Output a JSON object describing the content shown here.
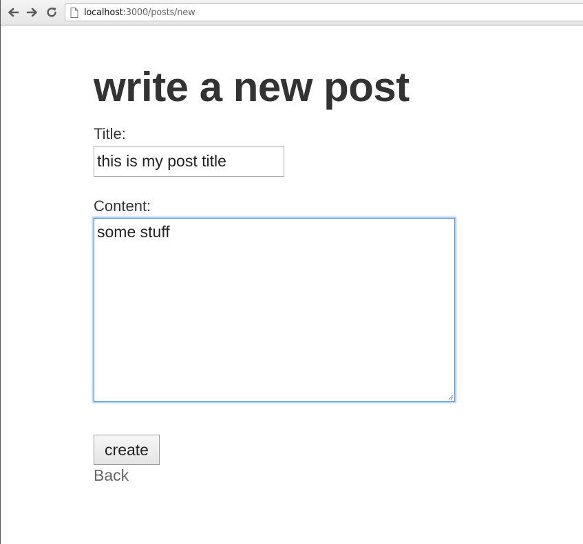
{
  "browser": {
    "url_host": "localhost",
    "url_path": ":3000/posts/new",
    "icons": {
      "back": "arrow-left-icon",
      "forward": "arrow-right-icon",
      "reload": "reload-icon",
      "page": "page-icon"
    }
  },
  "page": {
    "heading": "write a new post",
    "title_label": "Title:",
    "title_value": "this is my post title",
    "content_label": "Content:",
    "content_value": "some stuff",
    "create_button": "create",
    "back_link": "Back"
  },
  "colors": {
    "text": "#333333",
    "link": "#666666",
    "focus_ring": "#5b9ddf"
  }
}
